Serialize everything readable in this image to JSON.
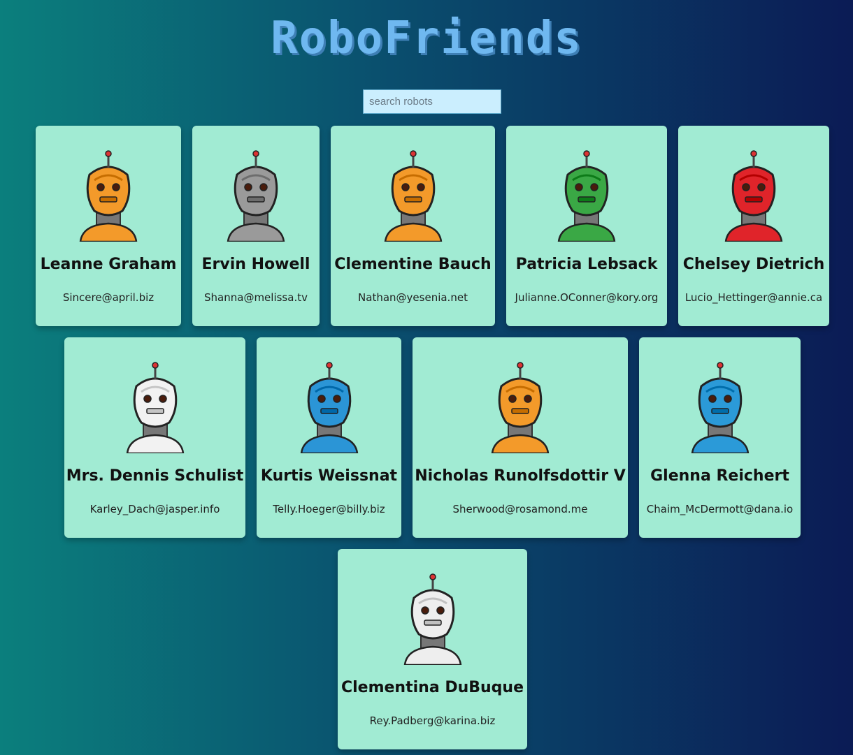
{
  "app": {
    "title": "RoboFriends"
  },
  "search": {
    "placeholder": "search robots",
    "value": ""
  },
  "robots": [
    {
      "name": "Leanne Graham",
      "email": "Sincere@april.biz",
      "color": "#f39a2a"
    },
    {
      "name": "Ervin Howell",
      "email": "Shanna@melissa.tv",
      "color": "#9a9a9a"
    },
    {
      "name": "Clementine Bauch",
      "email": "Nathan@yesenia.net",
      "color": "#f39a2a"
    },
    {
      "name": "Patricia Lebsack",
      "email": "Julianne.OConner@kory.org",
      "color": "#3aa845"
    },
    {
      "name": "Chelsey Dietrich",
      "email": "Lucio_Hettinger@annie.ca",
      "color": "#e0242a"
    },
    {
      "name": "Mrs. Dennis Schulist",
      "email": "Karley_Dach@jasper.info",
      "color": "#f2f2f2"
    },
    {
      "name": "Kurtis Weissnat",
      "email": "Telly.Hoeger@billy.biz",
      "color": "#2b95d6"
    },
    {
      "name": "Nicholas Runolfsdottir V",
      "email": "Sherwood@rosamond.me",
      "color": "#f39a2a"
    },
    {
      "name": "Glenna Reichert",
      "email": "Chaim_McDermott@dana.io",
      "color": "#2b9ad8"
    },
    {
      "name": "Clementina DuBuque",
      "email": "Rey.Padberg@karina.biz",
      "color": "#eeeeee"
    }
  ]
}
